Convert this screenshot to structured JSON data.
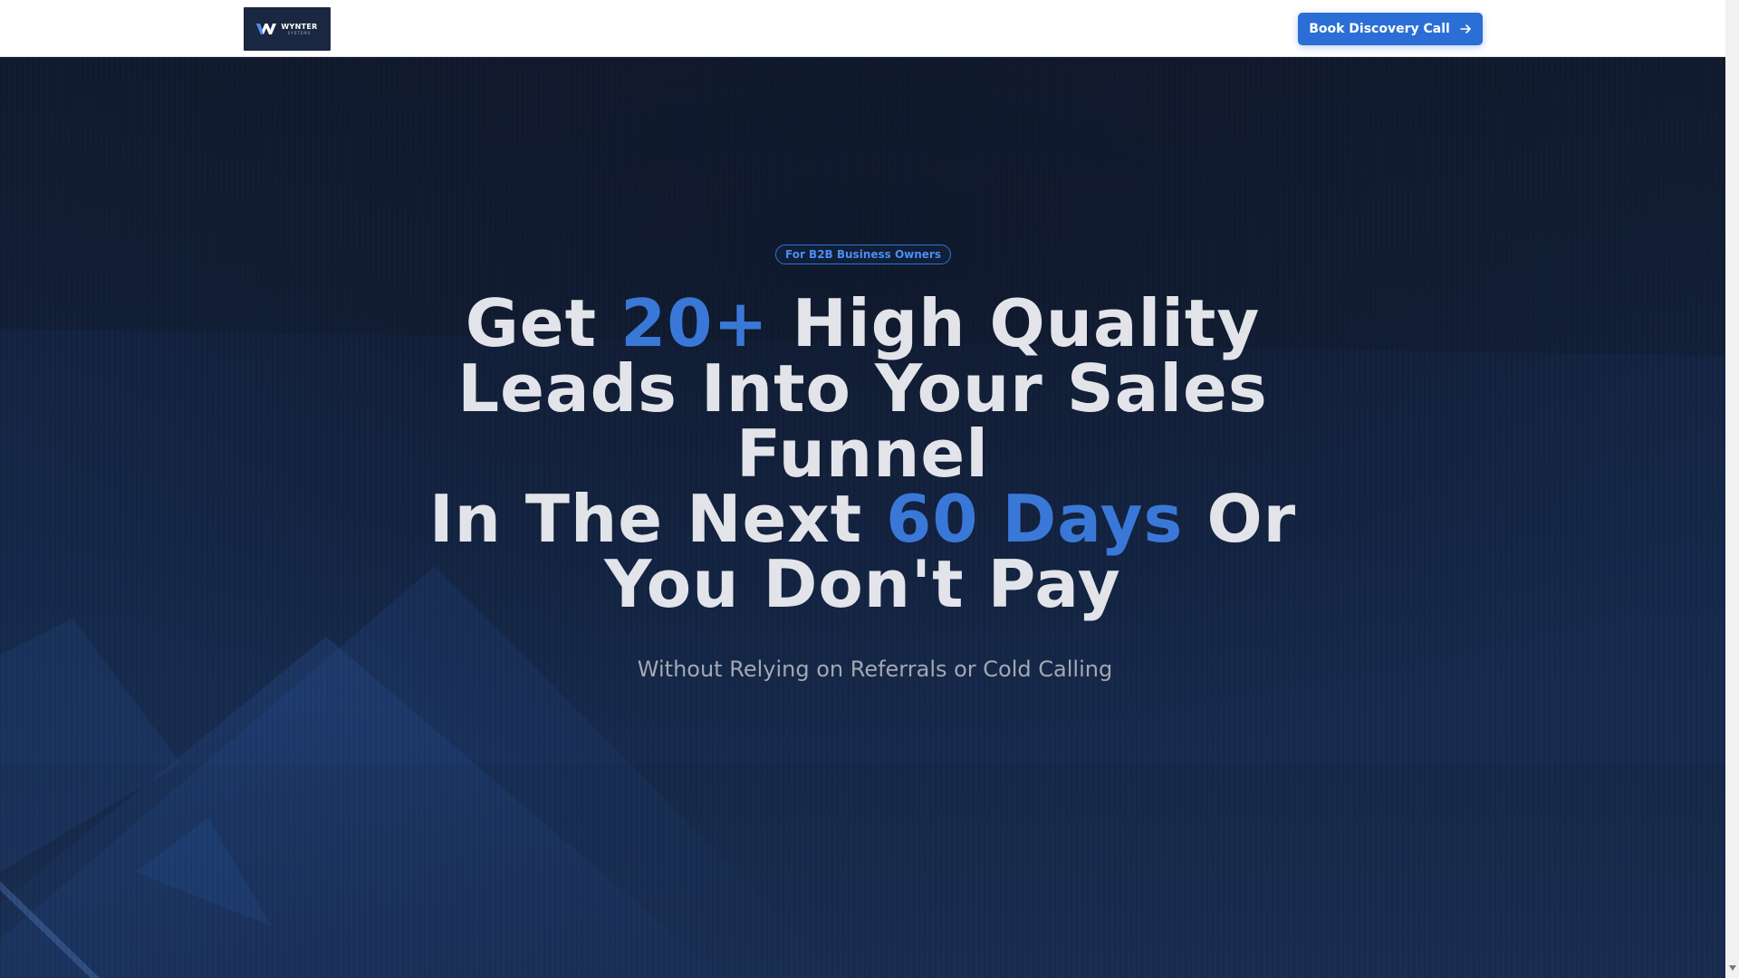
{
  "header": {
    "logo": {
      "name": "WYNTER",
      "sub": "SYSTEMS"
    },
    "cta_label": "Book Discovery Call"
  },
  "hero": {
    "badge": "For B2B Business Owners",
    "headline": {
      "line1_a": "Get ",
      "line1_accent": "20+",
      "line1_b": " High Quality Leads Into Your Sales Funnel",
      "line2_a": "In The Next ",
      "line2_accent": "60 Days",
      "line2_b": " Or You Don't Pay"
    },
    "subheadline": "Without Relying on Referrals or Cold Calling"
  },
  "colors": {
    "accent": "#3a78d8",
    "button": "#2b6fd6",
    "hero_bg": "#14233f",
    "headline": "#e2e4e9"
  }
}
